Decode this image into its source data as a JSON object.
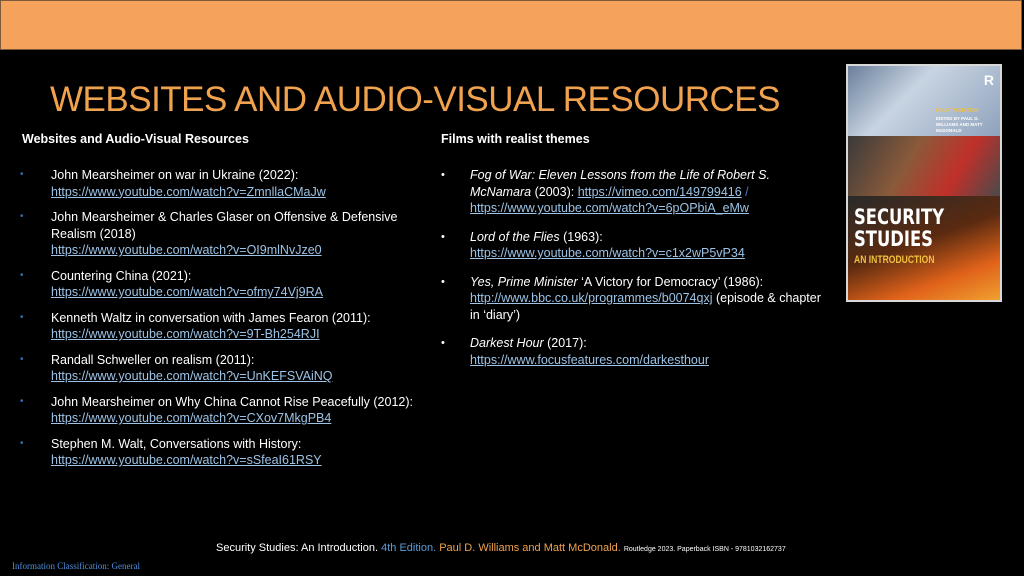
{
  "slide": {
    "title": "WEBSITES AND AUDIO-VISUAL RESOURCES"
  },
  "left_column": {
    "heading": "Websites and Audio-Visual Resources",
    "items": [
      {
        "text": "John Mearsheimer on war in Ukraine (2022):",
        "url": "https://www.youtube.com/watch?v=ZmnllaCMaJw"
      },
      {
        "text": "John Mearsheimer & Charles Glaser on Offensive & Defensive Realism (2018)",
        "url": "https://www.youtube.com/watch?v=OI9mlNvJze0"
      },
      {
        "text": "Countering China (2021):",
        "url": "https://www.youtube.com/watch?v=ofmy74Vj9RA"
      },
      {
        "text": "Kenneth Waltz in conversation with James Fearon (2011):",
        "url": "https://www.youtube.com/watch?v=9T-Bh254RJI"
      },
      {
        "text": "Randall Schweller on realism (2011):",
        "url": "https://www.youtube.com/watch?v=UnKEFSVAiNQ"
      },
      {
        "text": "John Mearsheimer on Why China Cannot Rise Peacefully (2012):",
        "url": "https://www.youtube.com/watch?v=CXov7MkgPB4"
      },
      {
        "text": "Stephen M. Walt, Conversations with History:",
        "url": "https://www.youtube.com/watch?v=sSfeaI61RSY"
      }
    ]
  },
  "right_column": {
    "heading": "Films with realist themes",
    "items": [
      {
        "title": "Fog of War: Eleven Lessons from the Life of Robert S. McNamara",
        "year": " (2003): ",
        "url": "https://vimeo.com/149799416",
        "separator": " / ",
        "url2": "https://www.youtube.com/watch?v=6pOPbiA_eMw"
      },
      {
        "title": "Lord of the Flies",
        "year": " (1963):",
        "url": "https://www.youtube.com/watch?v=c1x2wP5vP34"
      },
      {
        "title": "Yes, Prime Minister",
        "year": " ‘A Victory for Democracy’ (1986):",
        "url": "http://www.bbc.co.uk/programmes/b0074qxj",
        "note": " (episode & chapter in ‘diary’)"
      },
      {
        "title": "Darkest Hour",
        "year": " (2017):",
        "url": "https://www.focusfeatures.com/darkesthour"
      }
    ]
  },
  "book_cover": {
    "logo": "R",
    "edition": "FOURTH EDITION",
    "editors": "EDITED BY PAUL D. WILLIAMS AND MATT McDONALD",
    "title": "SECURITY STUDIES",
    "subtitle": "AN INTRODUCTION"
  },
  "footer": {
    "book": "Security Studies: An Introduction. ",
    "edition": "4th Edition. ",
    "authors": "Paul D. Williams and Matt McDonald. ",
    "publisher": "Routledge 2023. Paperback ISBN - 9781032162737"
  },
  "classification": "Information Classification: General",
  "colors": {
    "accent_orange": "#f0a24e",
    "top_bar": "#f5a35a",
    "link": "#9dc3e6",
    "footer_blue": "#5b9bd5"
  }
}
